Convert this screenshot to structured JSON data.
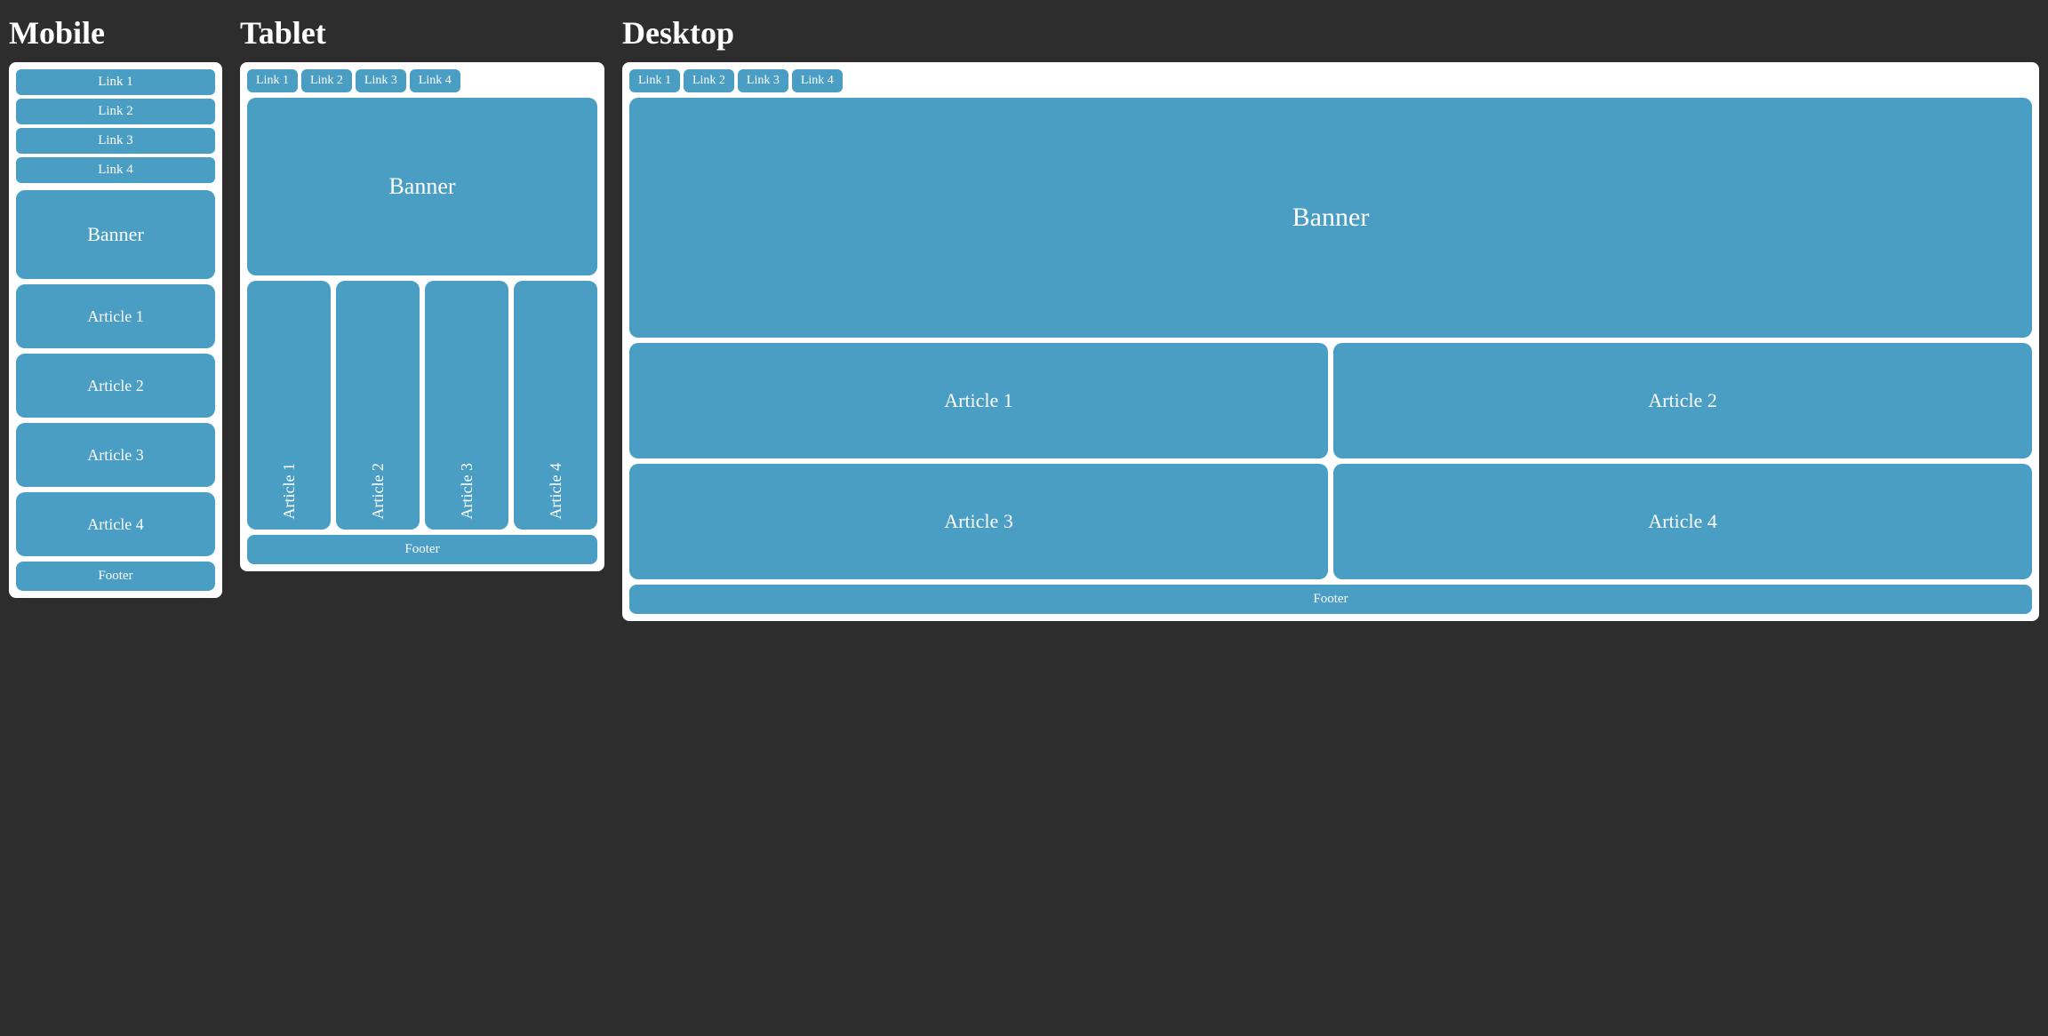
{
  "mobile": {
    "title": "Mobile",
    "nav": {
      "links": [
        "Link 1",
        "Link 2",
        "Link 3",
        "Link 4"
      ]
    },
    "banner": "Banner",
    "articles": [
      "Article 1",
      "Article 2",
      "Article 3",
      "Article 4"
    ],
    "footer": "Footer"
  },
  "tablet": {
    "title": "Tablet",
    "nav": {
      "links": [
        "Link 1",
        "Link 2",
        "Link 3",
        "Link 4"
      ]
    },
    "banner": "Banner",
    "articles": [
      "Article 1",
      "Article 2",
      "Article 3",
      "Article 4"
    ],
    "footer": "Footer"
  },
  "desktop": {
    "title": "Desktop",
    "nav": {
      "links": [
        "Link 1",
        "Link 2",
        "Link 3",
        "Link 4"
      ]
    },
    "banner": "Banner",
    "articles": [
      "Article 1",
      "Article 2",
      "Article 3",
      "Article 4"
    ],
    "footer": "Footer"
  },
  "colors": {
    "blue": "#4a9ec4",
    "bg": "#2d2d2d",
    "white": "#ffffff"
  }
}
